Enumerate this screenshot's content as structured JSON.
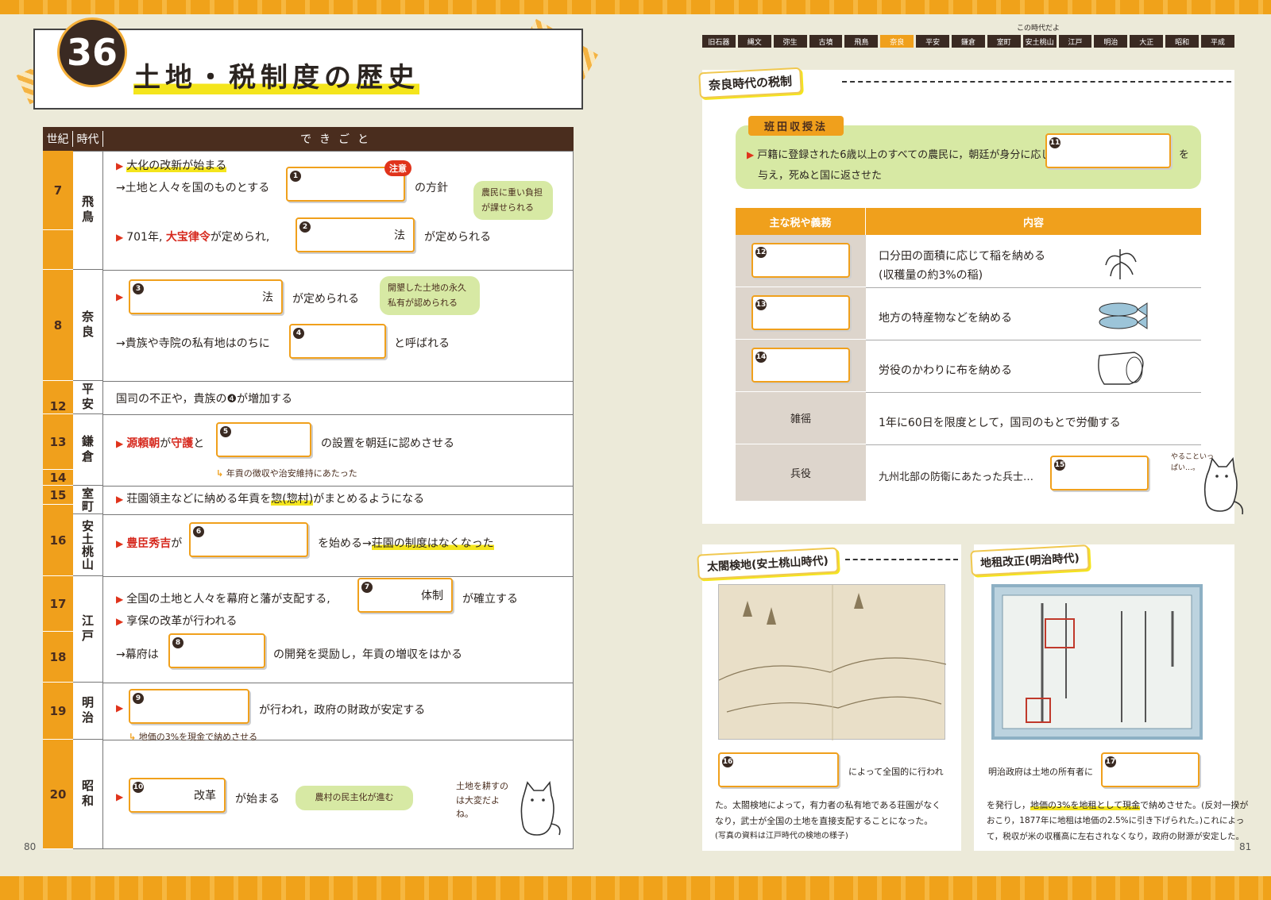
{
  "page_left": {
    "chapter_number": "36",
    "title": "土地・税制度の歴史",
    "table_headers": {
      "century": "世紀",
      "period": "時代",
      "events": "できごと"
    },
    "centuries": [
      "7",
      "8",
      "12",
      "13",
      "14",
      "15",
      "16",
      "17",
      "18",
      "19",
      "20"
    ],
    "periods": [
      "飛鳥",
      "奈良",
      "平安",
      "鎌倉",
      "室町",
      "安土桃山",
      "江戸",
      "明治",
      "昭和"
    ],
    "rows": {
      "r1a": "大化の改新が始まる",
      "r1b": "→土地と人々を国のものとする",
      "r1b_after": "の方針",
      "r1_warn": "注意",
      "r1_bubble": "農民に重い負担が課せられる",
      "r2_pre": "701年,",
      "r2_red": "大宝律令",
      "r2_mid": "が定められ,",
      "r2_sfx": "法",
      "r2_after": "が定められる",
      "r3_sfx": "法",
      "r3_after": "が定められる",
      "r3_bubble": "開墾した土地の永久私有が認められる",
      "r4_pre": "→貴族や寺院の私有地はのちに",
      "r4_after": "と呼ばれる",
      "r5": "国司の不正や，貴族の❹が増加する",
      "r6_red1": "源頼朝",
      "r6_mid1": "が",
      "r6_red2": "守護",
      "r6_mid2": "と",
      "r6_after": "の設置を朝廷に認めさせる",
      "r6_note": "年貢の徴収や治安維持にあたった",
      "r7_a": "荘園領主などに納める年貢を",
      "r7_hl": "惣(惣村)",
      "r7_b": "がまとめるようになる",
      "r8_red": "豊臣秀吉",
      "r8_mid": "が",
      "r8_a": "を始める→",
      "r8_hl": "荘園の制度はなくなった",
      "r9_a": "全国の土地と人々を幕府と藩が支配する,",
      "r9_sfx": "体制",
      "r9_after": "が確立する",
      "r10": "享保の改革が行われる",
      "r11_pre": "→幕府は",
      "r11_after": "の開発を奨励し，年貢の増収をはかる",
      "r12_after": "が行われ，政府の財政が安定する",
      "r12_note": "地価の3%を現金で納めさせる",
      "r13_sfx": "改革",
      "r13_after": "が始まる",
      "r13_bubble": "農村の民主化が進む",
      "cat_note": "土地を耕すのは大変だよね。"
    },
    "answer_numbers": [
      "1",
      "2",
      "3",
      "4",
      "5",
      "6",
      "7",
      "8",
      "9",
      "10"
    ],
    "page_number": "80"
  },
  "page_right": {
    "era_caption": "この時代だよ",
    "eras": [
      "旧石器",
      "縄文",
      "弥生",
      "古墳",
      "飛鳥",
      "奈良",
      "平安",
      "鎌倉",
      "室町",
      "安土桃山",
      "江戸",
      "明治",
      "大正",
      "昭和",
      "平成"
    ],
    "highlighted_era": "奈良",
    "section1_title": "奈良時代の税制",
    "handen_label": "班田収授法",
    "handen_text_a": "戸籍に登録された6歳以上のすべての農民に，朝廷が身分に応じて",
    "handen_text_b": "を",
    "handen_text_c": "与え，死ぬと国に返させた",
    "tax_headers": [
      "主な税や義務",
      "内容"
    ],
    "taxes": [
      {
        "name": "",
        "num": "12",
        "content": "口分田の面積に応じて稲を納める",
        "content2": "(収穫量の約3%の稲)"
      },
      {
        "name": "",
        "num": "13",
        "content": "地方の特産物などを納める",
        "content2": ""
      },
      {
        "name": "",
        "num": "14",
        "content": "労役のかわりに布を納める",
        "content2": ""
      },
      {
        "name": "雑徭",
        "num": "",
        "content": "1年に60日を限度として，国司のもとで労働する",
        "content2": ""
      },
      {
        "name": "兵役",
        "num": "15",
        "content": "九州北部の防衛にあたった兵士…",
        "content2": ""
      }
    ],
    "cat_note2": "やることいっぱい…。",
    "section2_title": "太閤検地(安土桃山時代)",
    "section2_text1": "によって全国的に行われ",
    "section2_text2": "た。太閤検地によって，有力者の私有地である荘園がなく",
    "section2_text3": "なり，武士が全国の土地を直接支配することになった。",
    "section2_caption": "(写真の資料は江戸時代の検地の様子)",
    "section3_title": "地租改正(明治時代)",
    "section3_text1": "明治政府は土地の所有者に",
    "section3_text2a": "を発行し，",
    "section3_text2hl": "地価の3%を地租として現金",
    "section3_text2b": "で納めさせた。(反対一揆が",
    "section3_text3": "おこり，1877年に地租は地価の2.5%に引き下げられた。)これによっ",
    "section3_text4": "て，税収が米の収穫高に左右されなくなり，政府の財源が安定した。",
    "answer_numbers": [
      "11",
      "16",
      "17"
    ],
    "page_number": "81"
  }
}
